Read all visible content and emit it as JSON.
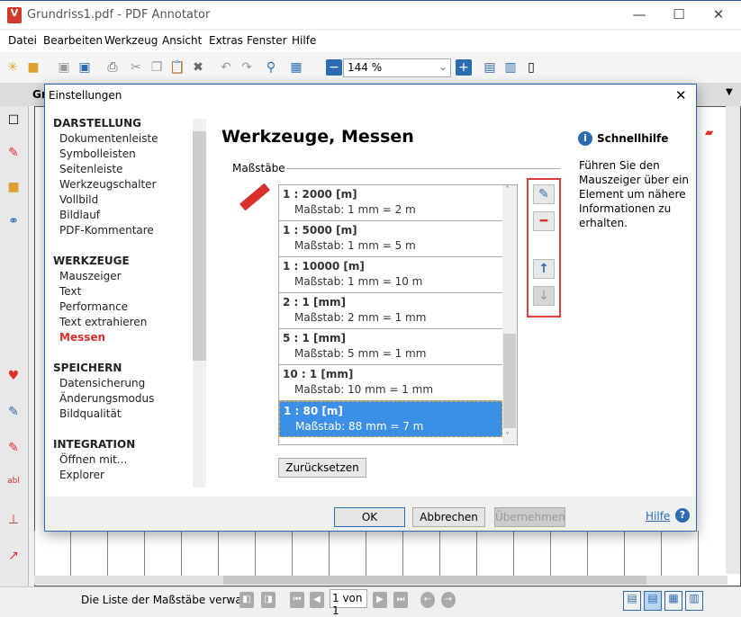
{
  "window": {
    "title": "Grundriss1.pdf - PDF Annotator",
    "minimize": "—",
    "maximize": "☐",
    "close": "✕"
  },
  "menu": [
    "Datei",
    "Bearbeiten",
    "Werkzeug",
    "Ansicht",
    "Extras",
    "Fenster",
    "Hilfe"
  ],
  "toolbar": {
    "zoom": "144 %"
  },
  "tab": {
    "label": "Gr"
  },
  "dialog": {
    "title": "Einstellungen",
    "close": "✕",
    "nav": [
      {
        "heading": "DARSTELLUNG",
        "items": [
          "Dokumentenleiste",
          "Symbolleisten",
          "Seitenleiste",
          "Werkzeugschalter",
          "Vollbild",
          "Bildlauf",
          "PDF-Kommentare"
        ]
      },
      {
        "heading": "WERKZEUGE",
        "items": [
          "Mauszeiger",
          "Text",
          "Performance",
          "Text extrahieren",
          "Messen"
        ]
      },
      {
        "heading": "SPEICHERN",
        "items": [
          "Datensicherung",
          "Änderungsmodus",
          "Bildqualität"
        ]
      },
      {
        "heading": "INTEGRATION",
        "items": [
          "Öffnen mit...",
          "Explorer"
        ]
      }
    ],
    "selected_nav": "Messen",
    "heading": "Werkzeuge, Messen",
    "group": "Maßstäbe",
    "scales": [
      {
        "name": "1 : 2000 [m]",
        "desc": "Maßstab: 1 mm = 2 m"
      },
      {
        "name": "1 : 5000 [m]",
        "desc": "Maßstab: 1 mm = 5 m"
      },
      {
        "name": "1 : 10000 [m]",
        "desc": "Maßstab: 1 mm = 10 m"
      },
      {
        "name": "2 : 1 [mm]",
        "desc": "Maßstab: 2 mm = 1 mm"
      },
      {
        "name": "5 : 1 [mm]",
        "desc": "Maßstab: 5 mm = 1 mm"
      },
      {
        "name": "10 : 1 [mm]",
        "desc": "Maßstab: 10 mm = 1 mm"
      },
      {
        "name": "1 : 80 [m]",
        "desc": "Maßstab: 88 mm = 7 m"
      }
    ],
    "selected_scale": "1 : 80 [m]",
    "reset": "Zurücksetzen",
    "help": {
      "title": "Schnellhilfe",
      "text": "Führen Sie den Mauszeiger über ein Element um nähere Informationen zu erhalten."
    },
    "ok": "OK",
    "cancel": "Abbrechen",
    "apply": "Übernehmen",
    "help_link": "Hilfe",
    "colors": {
      "accent": "#2b6cb0",
      "highlight": "#d9302c",
      "selection": "#3c8fe6"
    }
  },
  "status": {
    "message": "Die Liste der Maßstäbe verwa...",
    "page": "1 von 1"
  }
}
